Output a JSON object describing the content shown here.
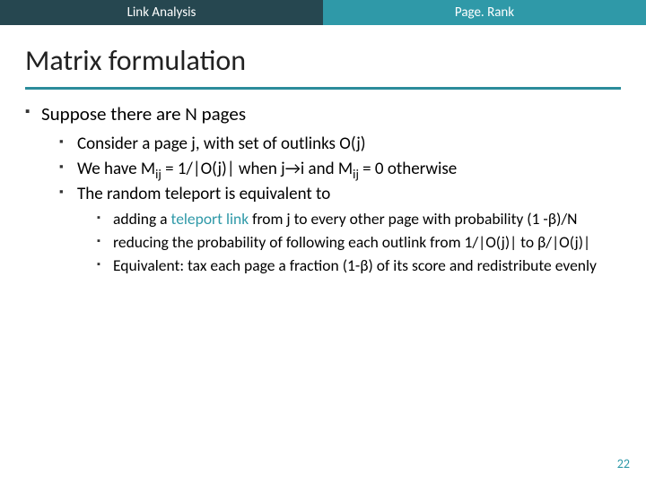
{
  "tabs": {
    "left": "Link Analysis",
    "right": "Page. Rank"
  },
  "title": "Matrix formulation",
  "b1": "Suppose there are N pages",
  "b1_1": "Consider a page j, with set of outlinks O(j)",
  "b1_2_a": "We have M",
  "b1_2_b": " = 1/|O(j)| when j→i and M",
  "b1_2_c": " = 0 otherwise",
  "b1_2_sub": "ij",
  "b1_3": "The random teleport is equivalent to",
  "b1_3_1_a": "adding a ",
  "b1_3_1_link": "teleport link",
  "b1_3_1_b": " from j to every other page with probability (1 -β)/N",
  "b1_3_2": "reducing the probability of following each outlink from 1/|O(j)| to β/|O(j)|",
  "b1_3_3": "Equivalent: tax each page a fraction (1-β) of its score and redistribute evenly",
  "page": "22"
}
